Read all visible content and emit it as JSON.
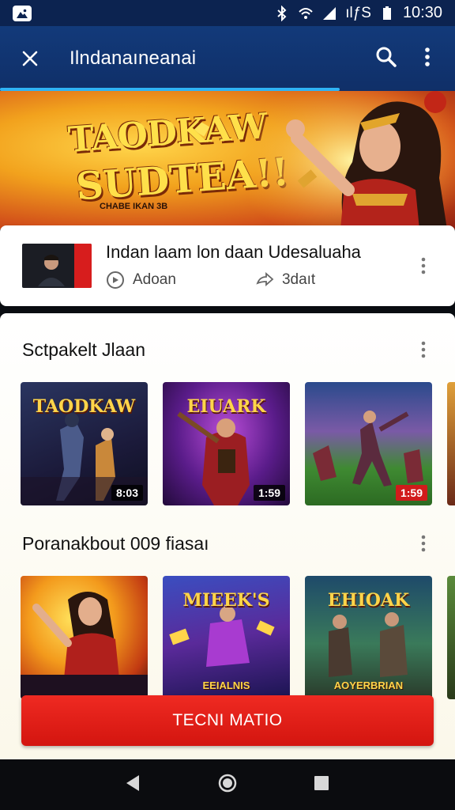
{
  "status_bar": {
    "network_text": "ılƒS",
    "time": "10:30"
  },
  "app_bar": {
    "title": "Ilndanaıneanai",
    "close_icon": "close-icon",
    "search_icon": "search-icon",
    "more_icon": "more-vert-icon"
  },
  "hero": {
    "logo_line1": "TAODKAW",
    "logo_line2": "SUDTEA!!",
    "logo_small": "CHABE IKAN 3B"
  },
  "channel_card": {
    "title": "Indan laam lon daan Udesaluaha",
    "meta_left": "Adoan",
    "meta_right": "3daıt"
  },
  "sections": [
    {
      "heading": "Sctpakelt Jlaan",
      "tiles": [
        {
          "logo": "TAODKAW",
          "badge": "8:03",
          "badge_style": "dark"
        },
        {
          "logo": "EIUARK",
          "badge": "1:59",
          "badge_style": "dark"
        },
        {
          "logo": "",
          "badge": "1:59",
          "badge_style": "red"
        }
      ]
    },
    {
      "heading": "Poranakbout 009 fiasaı",
      "tiles": [
        {
          "logo": "",
          "badge": "",
          "sub": ""
        },
        {
          "logo": "MIEEK'S",
          "badge": "",
          "sub": "EEIALNIS"
        },
        {
          "logo": "EHIOAK",
          "badge": "",
          "sub": "AOYERBRIAN"
        }
      ]
    }
  ],
  "cta": {
    "label": "TECNI MATIO"
  },
  "nav": {
    "back_icon": "back-triangle-icon",
    "home_icon": "home-circle-icon",
    "recents_icon": "recents-square-icon"
  }
}
